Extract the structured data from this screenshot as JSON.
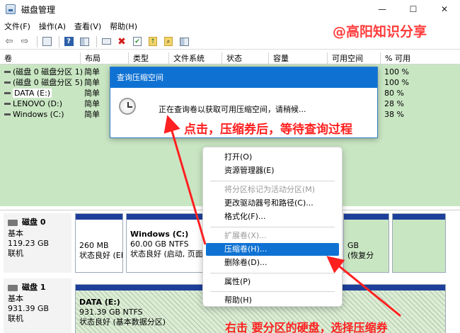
{
  "window": {
    "title": "磁盘管理",
    "controls": {
      "minimize": "—",
      "maximize": "☐",
      "close": "✕"
    }
  },
  "menu": [
    "文件(F)",
    "操作(A)",
    "查看(V)",
    "帮助(H)"
  ],
  "watermark": "@高阳知识分享",
  "table": {
    "headers": [
      "卷",
      "布局",
      "类型",
      "文件系统",
      "状态",
      "容量",
      "可用空间",
      "% 可用"
    ],
    "rows": [
      {
        "name": "(磁盘 0 磁盘分区 1)",
        "layout": "简单",
        "free_pct": "100 %"
      },
      {
        "name": "(磁盘 0 磁盘分区 5)",
        "layout": "简单",
        "free_pct": "100 %"
      },
      {
        "name": "DATA (E:)",
        "layout": "简单",
        "free_pct": "80 %"
      },
      {
        "name": "LENOVO (D:)",
        "layout": "简单",
        "free_pct": "28 %"
      },
      {
        "name": "Windows (C:)",
        "layout": "简单",
        "free_pct": "38 %"
      }
    ]
  },
  "dialog": {
    "title": "查询压缩空间",
    "message": "正在查询卷以获取可用压缩空间，请稍候..."
  },
  "disks": [
    {
      "name": "磁盘 0",
      "type": "基本",
      "size": "119.23 GB",
      "status": "联机",
      "partitions": [
        {
          "line1": "",
          "line2": "260 MB",
          "line3": "状态良好 (EF"
        },
        {
          "line1": "Windows  (C:)",
          "line2": "60.00 GB NTFS",
          "line3": "状态良好 (启动, 页面文"
        },
        {
          "line1": "",
          "line2": "GB",
          "line3": "(恢复分"
        }
      ]
    },
    {
      "name": "磁盘 1",
      "type": "基本",
      "size": "931.39 GB",
      "status": "联机",
      "partitions": [
        {
          "line1": "DATA  (E:)",
          "line2": "931.39 GB NTFS",
          "line3": "状态良好 (基本数据分区)"
        }
      ]
    }
  ],
  "context_menu": {
    "items": [
      {
        "label": "打开(O)",
        "enabled": true
      },
      {
        "label": "资源管理器(E)",
        "enabled": true
      },
      {
        "label": "将分区标记为活动分区(M)",
        "enabled": false
      },
      {
        "label": "更改驱动器号和路径(C)...",
        "enabled": true
      },
      {
        "label": "格式化(F)...",
        "enabled": true
      },
      {
        "label": "扩展卷(X)...",
        "enabled": false
      },
      {
        "label": "压缩卷(H)...",
        "enabled": true,
        "active": true
      },
      {
        "label": "删除卷(D)...",
        "enabled": true
      },
      {
        "label": "属性(P)",
        "enabled": true
      },
      {
        "label": "帮助(H)",
        "enabled": true
      }
    ]
  },
  "annotations": {
    "top": "点击，压缩券后，等待查询过程",
    "bottom": "右击  要分区的硬盘，选择压缩券",
    "color": "#ff2020"
  },
  "colors": {
    "accent": "#0f72d3",
    "volume_bg": "#c9e6c3",
    "partition_bar": "#1e3f9a"
  }
}
